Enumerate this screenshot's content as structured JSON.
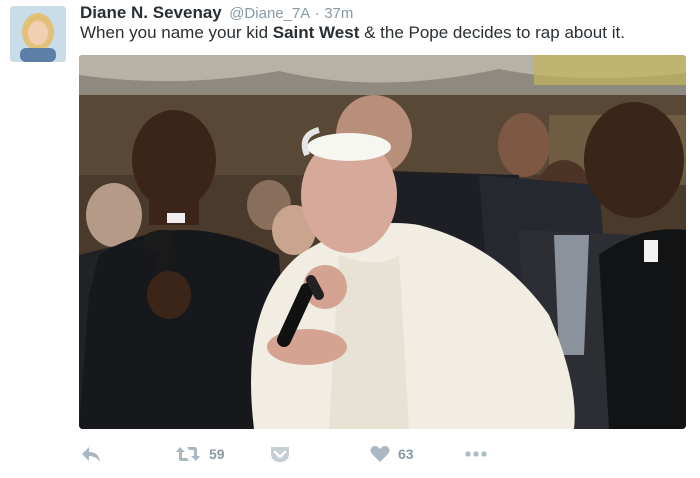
{
  "tweet": {
    "author_name": "Diane N. Sevenay",
    "handle": "@Diane_7A",
    "separator": "·",
    "time": "37m",
    "text_before": "When you name your kid ",
    "text_bold": "Saint West",
    "text_after": " & the Pope decides to rap about it."
  },
  "actions": {
    "retweet_count": "59",
    "like_count": "63",
    "icons": [
      "reply-icon",
      "retweet-icon",
      "pocket-icon",
      "heart-icon",
      "more-icon"
    ]
  },
  "colors": {
    "text": "#292f33",
    "muted": "#8899a6",
    "icon": "#aab8c2"
  }
}
